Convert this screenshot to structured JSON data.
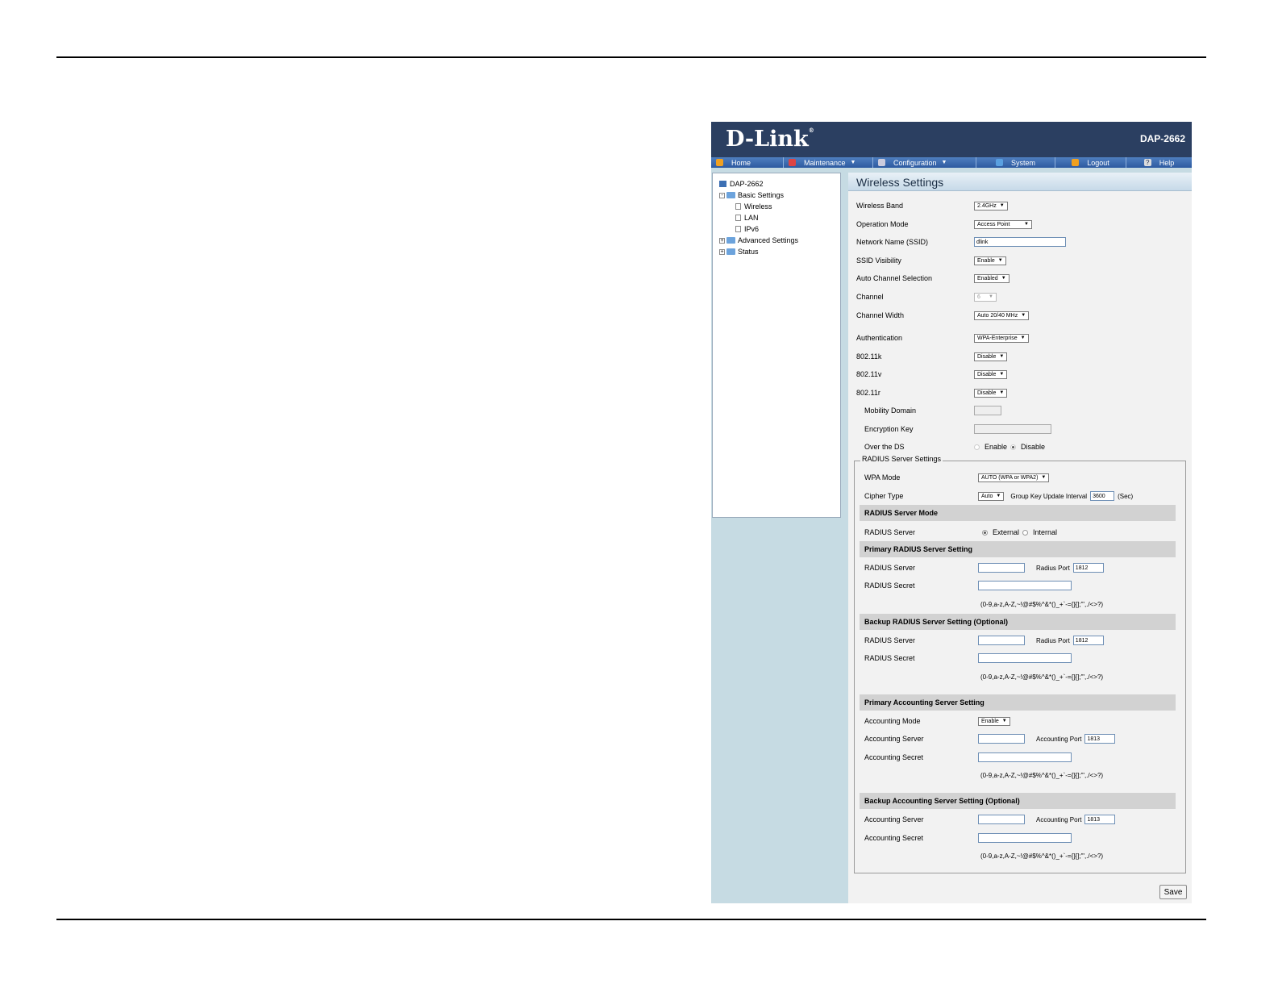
{
  "header": {
    "brand": "D-Link",
    "model": "DAP-2662"
  },
  "nav": [
    {
      "label": "Home",
      "icon": "home-icon",
      "caret": false
    },
    {
      "label": "Maintenance",
      "icon": "tools-icon",
      "caret": true
    },
    {
      "label": "Configuration",
      "icon": "config-icon",
      "caret": true
    },
    {
      "label": "System",
      "icon": "system-icon",
      "caret": false
    },
    {
      "label": "Logout",
      "icon": "logout-icon",
      "caret": false
    },
    {
      "label": "Help",
      "icon": "help-icon",
      "caret": false
    }
  ],
  "tree": {
    "root": "DAP-2662",
    "basic": "Basic Settings",
    "wireless": "Wireless",
    "lan": "LAN",
    "ipv6": "IPv6",
    "advanced": "Advanced Settings",
    "status": "Status"
  },
  "content": {
    "title": "Wireless Settings",
    "wireless_band": {
      "label": "Wireless Band",
      "value": "2.4GHz"
    },
    "operation_mode": {
      "label": "Operation Mode",
      "value": "Access Point"
    },
    "ssid": {
      "label": "Network Name (SSID)",
      "value": "dlink"
    },
    "ssid_visibility": {
      "label": "SSID Visibility",
      "value": "Enable"
    },
    "auto_channel": {
      "label": "Auto Channel Selection",
      "value": "Enabled"
    },
    "channel": {
      "label": "Channel",
      "value": "6"
    },
    "channel_width": {
      "label": "Channel Width",
      "value": "Auto 20/40 MHz"
    },
    "authentication": {
      "label": "Authentication",
      "value": "WPA-Enterprise"
    },
    "k80211": {
      "label": "802.11k",
      "value": "Disable"
    },
    "v80211": {
      "label": "802.11v",
      "value": "Disable"
    },
    "r80211": {
      "label": "802.11r",
      "value": "Disable"
    },
    "mobility_domain": {
      "label": "Mobility Domain"
    },
    "encryption_key": {
      "label": "Encryption Key"
    },
    "over_ds": {
      "label": "Over the DS",
      "enable": "Enable",
      "disable": "Disable"
    }
  },
  "radius": {
    "legend": "RADIUS Server Settings",
    "wpa_mode": {
      "label": "WPA Mode",
      "value": "AUTO (WPA or WPA2)"
    },
    "cipher": {
      "label": "Cipher Type",
      "value": "Auto",
      "gkui_label": "Group Key Update Interval",
      "gkui_value": "3600",
      "unit": "(Sec)"
    },
    "mode_band": "RADIUS Server Mode",
    "server_mode": {
      "label": "RADIUS Server",
      "external": "External",
      "internal": "Internal"
    },
    "primary_band": "Primary RADIUS Server Setting",
    "backup_band": "Backup RADIUS Server Setting (Optional)",
    "server_label": "RADIUS Server",
    "port_label": "Radius Port",
    "port_value": "1812",
    "secret_label": "RADIUS Secret",
    "charset": "(0-9,a-z,A-Z,~!@#$%^&*()_+`-={}[];'\",./<>?)",
    "acct_primary_band": "Primary Accounting Server Setting",
    "acct_backup_band": "Backup Accounting Server Setting (Optional)",
    "acct_mode": {
      "label": "Accounting Mode",
      "value": "Enable"
    },
    "acct_server_label": "Accounting Server",
    "acct_port_label": "Accounting Port",
    "acct_port_value": "1813",
    "acct_secret_label": "Accounting Secret"
  },
  "save_label": "Save"
}
